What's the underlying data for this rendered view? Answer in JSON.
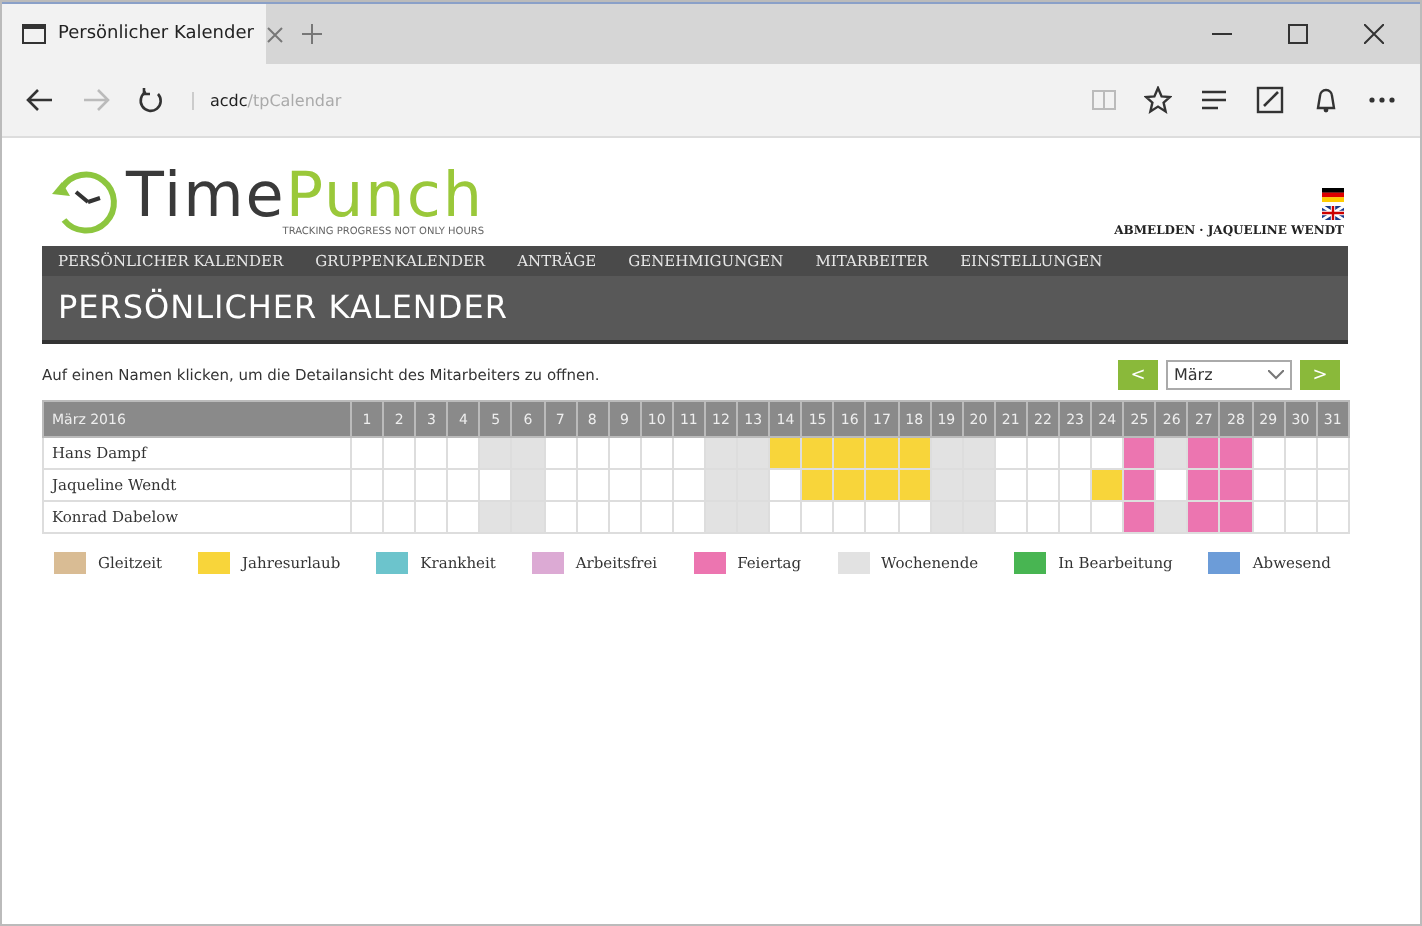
{
  "browser": {
    "tab_title": "Persönlicher Kalender",
    "address_host": "acdc",
    "address_path": "/tpCalendar"
  },
  "logo": {
    "word_dark": "Time",
    "word_green": "Punch",
    "tagline": "TRACKING PROGRESS NOT ONLY HOURS"
  },
  "user_line": "ABMELDEN · JAQUELINE WENDT",
  "nav": [
    "PERSÖNLICHER KALENDER",
    "GRUPPENKALENDER",
    "ANTRÄGE",
    "GENEHMIGUNGEN",
    "MITARBEITER",
    "EINSTELLUNGEN"
  ],
  "page_title": "PERSÖNLICHER KALENDER",
  "hint": "Auf einen Namen klicken, um die Detailansicht des Mitarbeiters zu offnen.",
  "month_nav": {
    "prev": "<",
    "month": "März",
    "next": ">"
  },
  "calendar": {
    "month_label": "März 2016",
    "days": [
      "1",
      "2",
      "3",
      "4",
      "5",
      "6",
      "7",
      "8",
      "9",
      "10",
      "11",
      "12",
      "13",
      "14",
      "15",
      "16",
      "17",
      "18",
      "19",
      "20",
      "21",
      "22",
      "23",
      "24",
      "25",
      "26",
      "27",
      "28",
      "29",
      "30",
      "31"
    ],
    "rows": [
      {
        "name": "Hans Dampf",
        "cells": [
          {
            "kind": "none"
          },
          {
            "kind": "none"
          },
          {
            "kind": "none"
          },
          {
            "kind": "none"
          },
          {
            "kind": "weekend"
          },
          {
            "kind": "weekend"
          },
          {
            "kind": "none"
          },
          {
            "kind": "none"
          },
          {
            "kind": "none"
          },
          {
            "kind": "none"
          },
          {
            "kind": "none"
          },
          {
            "kind": "weekend"
          },
          {
            "kind": "weekend"
          },
          {
            "kind": "vacation"
          },
          {
            "kind": "vacation"
          },
          {
            "kind": "vacation"
          },
          {
            "kind": "vacation"
          },
          {
            "kind": "vacation"
          },
          {
            "kind": "weekend"
          },
          {
            "kind": "weekend"
          },
          {
            "kind": "none"
          },
          {
            "kind": "none"
          },
          {
            "kind": "none"
          },
          {
            "kind": "none"
          },
          {
            "kind": "holiday"
          },
          {
            "kind": "weekend"
          },
          {
            "kind": "holiday"
          },
          {
            "kind": "holiday"
          },
          {
            "kind": "none"
          },
          {
            "kind": "none"
          },
          {
            "kind": "none"
          }
        ]
      },
      {
        "name": "Jaqueline Wendt",
        "cells": [
          {
            "kind": "none"
          },
          {
            "kind": "none"
          },
          {
            "kind": "none"
          },
          {
            "kind": "none"
          },
          {
            "kind": "none"
          },
          {
            "kind": "weekend"
          },
          {
            "kind": "none"
          },
          {
            "kind": "none"
          },
          {
            "kind": "none"
          },
          {
            "kind": "none"
          },
          {
            "kind": "none"
          },
          {
            "kind": "weekend"
          },
          {
            "kind": "weekend"
          },
          {
            "kind": "none"
          },
          {
            "kind": "vacation"
          },
          {
            "kind": "vacation"
          },
          {
            "kind": "vacation"
          },
          {
            "kind": "vacation"
          },
          {
            "kind": "weekend"
          },
          {
            "kind": "weekend"
          },
          {
            "kind": "none"
          },
          {
            "kind": "none"
          },
          {
            "kind": "none"
          },
          {
            "kind": "vacation"
          },
          {
            "kind": "holiday"
          },
          {
            "kind": "none"
          },
          {
            "kind": "holiday"
          },
          {
            "kind": "holiday"
          },
          {
            "kind": "none"
          },
          {
            "kind": "none"
          },
          {
            "kind": "none"
          }
        ]
      },
      {
        "name": "Konrad Dabelow",
        "cells": [
          {
            "kind": "none"
          },
          {
            "kind": "none"
          },
          {
            "kind": "none"
          },
          {
            "kind": "none"
          },
          {
            "kind": "weekend"
          },
          {
            "kind": "weekend"
          },
          {
            "kind": "none"
          },
          {
            "kind": "none"
          },
          {
            "kind": "none"
          },
          {
            "kind": "none"
          },
          {
            "kind": "none"
          },
          {
            "kind": "weekend"
          },
          {
            "kind": "weekend"
          },
          {
            "kind": "none"
          },
          {
            "kind": "none"
          },
          {
            "kind": "none"
          },
          {
            "kind": "none"
          },
          {
            "kind": "none"
          },
          {
            "kind": "weekend"
          },
          {
            "kind": "weekend"
          },
          {
            "kind": "none"
          },
          {
            "kind": "none"
          },
          {
            "kind": "none"
          },
          {
            "kind": "none"
          },
          {
            "kind": "holiday"
          },
          {
            "kind": "weekend"
          },
          {
            "kind": "holiday"
          },
          {
            "kind": "holiday"
          },
          {
            "kind": "none"
          },
          {
            "kind": "none"
          },
          {
            "kind": "none"
          }
        ]
      }
    ]
  },
  "legend": [
    {
      "kind": "flextime",
      "label": "Gleitzeit",
      "color": "#d9bc94"
    },
    {
      "kind": "vacation",
      "label": "Jahresurlaub",
      "color": "#f8d53a"
    },
    {
      "kind": "sick",
      "label": "Krankheit",
      "color": "#6cc4cc"
    },
    {
      "kind": "off",
      "label": "Arbeitsfrei",
      "color": "#dcaad4"
    },
    {
      "kind": "holiday",
      "label": "Feiertag",
      "color": "#ec75b0"
    },
    {
      "kind": "weekend",
      "label": "Wochenende",
      "color": "#e2e2e2"
    },
    {
      "kind": "pending",
      "label": "In Bearbeitung",
      "color": "#48b552"
    },
    {
      "kind": "absent",
      "label": "Abwesend",
      "color": "#6c9cd8"
    }
  ]
}
